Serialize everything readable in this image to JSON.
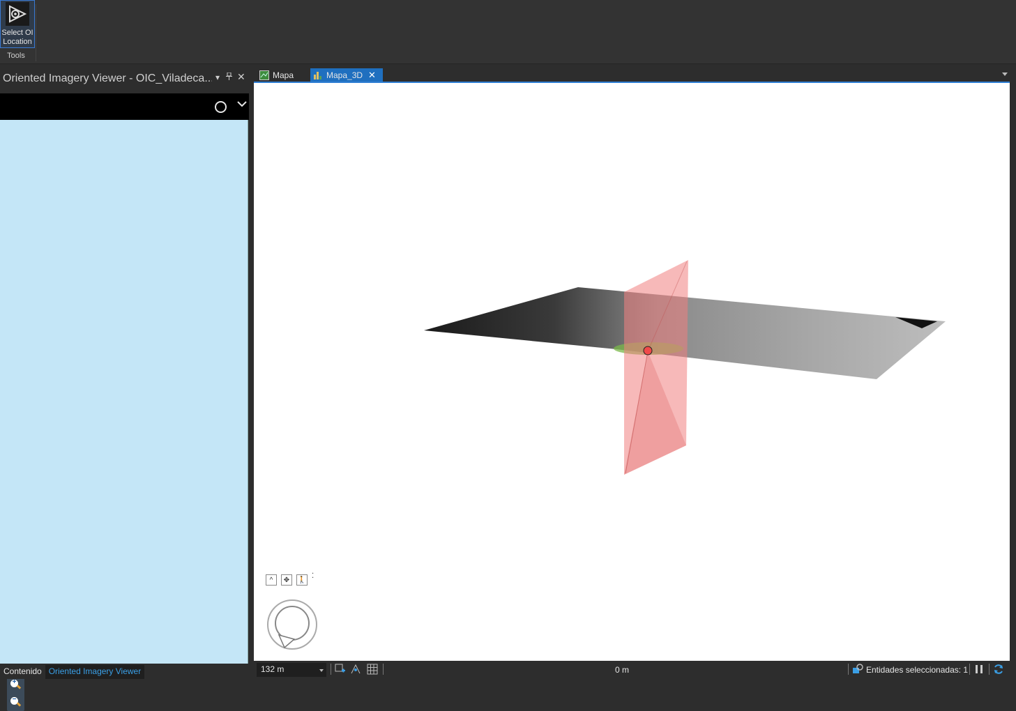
{
  "ribbon": {
    "tool_label": "Select OI Location",
    "group_label": "Tools"
  },
  "left_pane": {
    "title": "Oriented Imagery Viewer - OIC_Viladeca...",
    "bottom_tabs": [
      "Contenido",
      "Oriented Imagery Viewer"
    ],
    "active_tab": "Oriented Imagery Viewer",
    "background_color": "#c4e6f7"
  },
  "map": {
    "tabs": [
      {
        "label": "Mapa",
        "icon": "map-2d-icon"
      },
      {
        "label": "Mapa_3D",
        "icon": "scene-3d-icon",
        "active": true
      }
    ]
  },
  "status_bar": {
    "scale": "132 m",
    "elevation": "0 m",
    "selected_text": "Entidades seleccionadas: 1"
  },
  "colors": {
    "accent": "#1f6fbf",
    "frustum": "#f08080"
  }
}
